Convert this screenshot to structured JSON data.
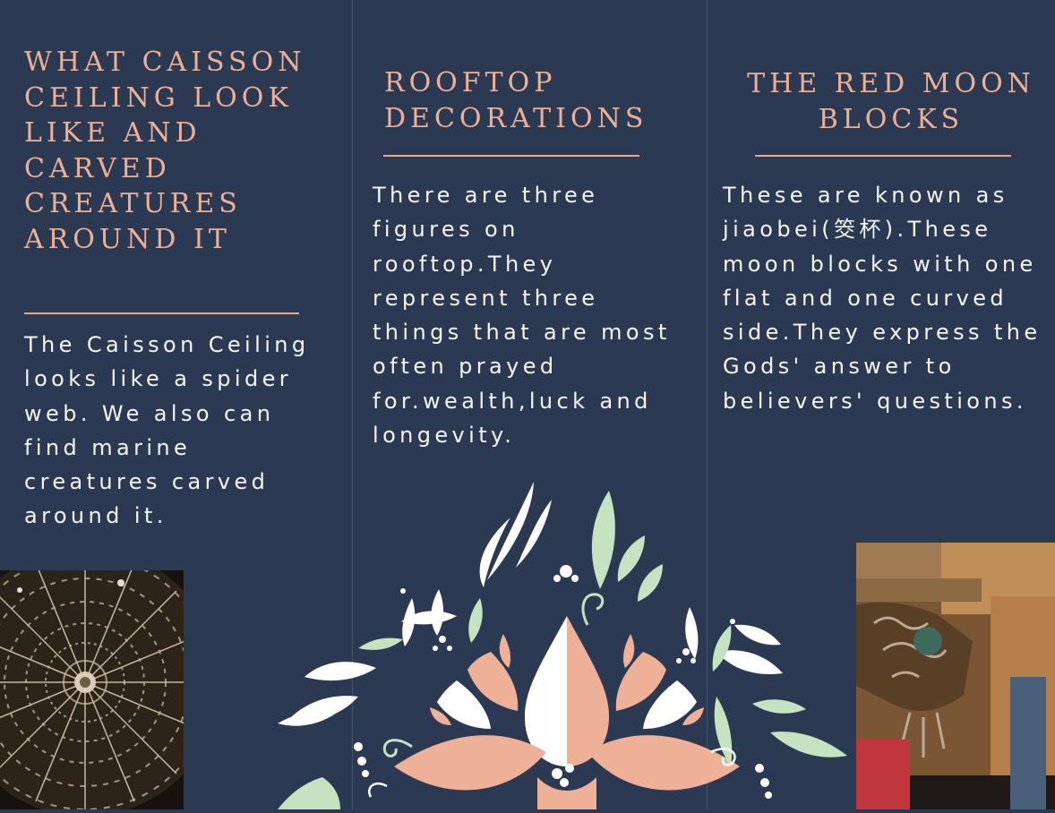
{
  "columns": [
    {
      "heading": "WHAT CAISSON CEILING LOOK LIKE AND CARVED CREATURES AROUND IT",
      "body": "The Caisson Ceiling looks like a spider web. We also can find marine creatures carved around it."
    },
    {
      "heading": "ROOFTOP DECORATIONS",
      "body": "There are three figures on rooftop.They represent three things that are most often prayed for.wealth,luck and longevity."
    },
    {
      "heading": "THE RED MOON BLOCKS",
      "body": "These are known as jiaobei(筊杯).These moon blocks with one flat and one curved side.They express the Gods' answer to believers' questions."
    }
  ],
  "colors": {
    "background": "#2b3a52",
    "heading": "#eeb095",
    "rule": "#e8a98b",
    "body_text": "#f4f4f4",
    "ornament_peach": "#efb098",
    "ornament_white": "#ffffff",
    "ornament_green": "#c5e3c0"
  },
  "images": {
    "caisson": "caisson-ceiling-photo",
    "moon_blocks": "carved-temple-bracket-photo",
    "ornament": "floral-folk-ornament"
  }
}
